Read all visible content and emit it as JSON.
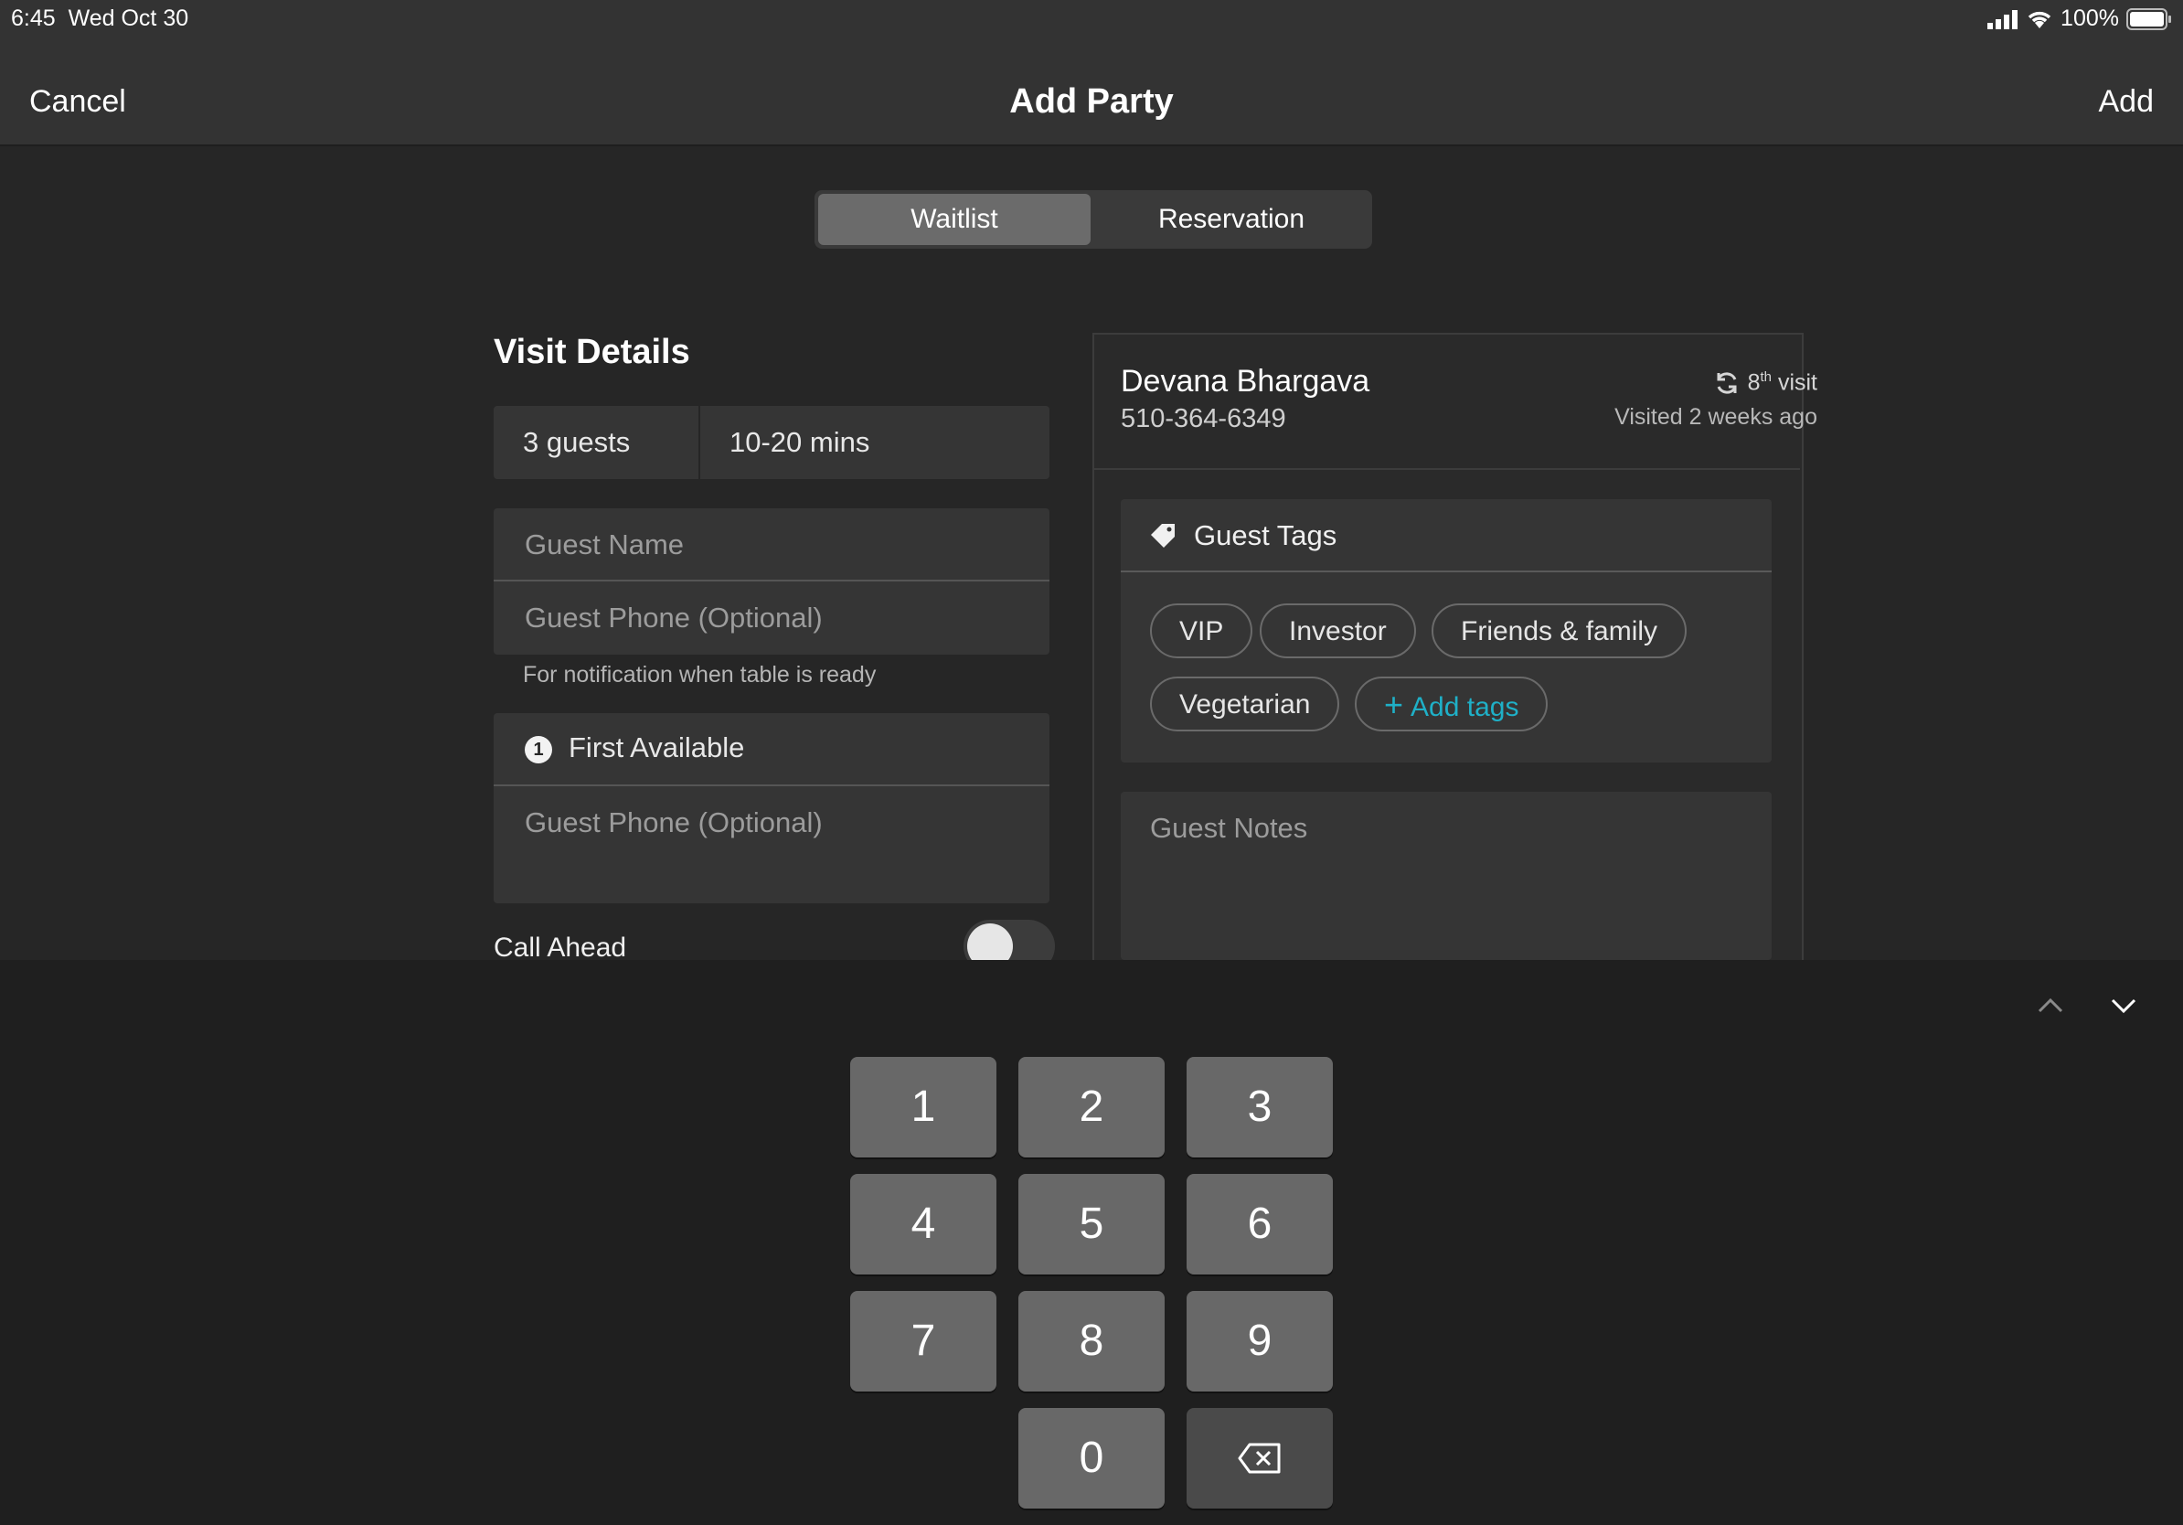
{
  "status": {
    "time": "6:45",
    "date": "Wed Oct 30",
    "battery": "100%",
    "signal_icon": "cellular-signal-icon",
    "wifi_icon": "wifi-icon",
    "battery_icon": "battery-icon"
  },
  "nav": {
    "cancel": "Cancel",
    "title": "Add Party",
    "add": "Add"
  },
  "segment": {
    "waitlist": "Waitlist",
    "reservation": "Reservation",
    "selected": "Waitlist"
  },
  "visit": {
    "heading": "Visit Details",
    "guests": "3 guests",
    "wait": "10-20 mins",
    "name_placeholder": "Guest Name",
    "phone_placeholder": "Guest Phone (Optional)",
    "phone_hint": "For notification when table is ready",
    "seating_badge": "1",
    "seating": "First Available",
    "phone2_placeholder": "Guest Phone (Optional)",
    "call_ahead": "Call Ahead",
    "call_ahead_on": false
  },
  "guest": {
    "name": "Devana Bhargava",
    "phone": "510-364-6349",
    "visit_number": "8",
    "visit_suffix": "th",
    "visit_word": "visit",
    "last_visit": "Visited 2 weeks ago",
    "tags_title": "Guest Tags",
    "tags": [
      "VIP",
      "Investor",
      "Friends & family",
      "Vegetarian"
    ],
    "add_tags": "Add tags",
    "notes_placeholder": "Guest Notes"
  },
  "keyboard": {
    "keys": [
      "1",
      "2",
      "3",
      "4",
      "5",
      "6",
      "7",
      "8",
      "9",
      "0"
    ],
    "accent": "#1fb0c7"
  }
}
